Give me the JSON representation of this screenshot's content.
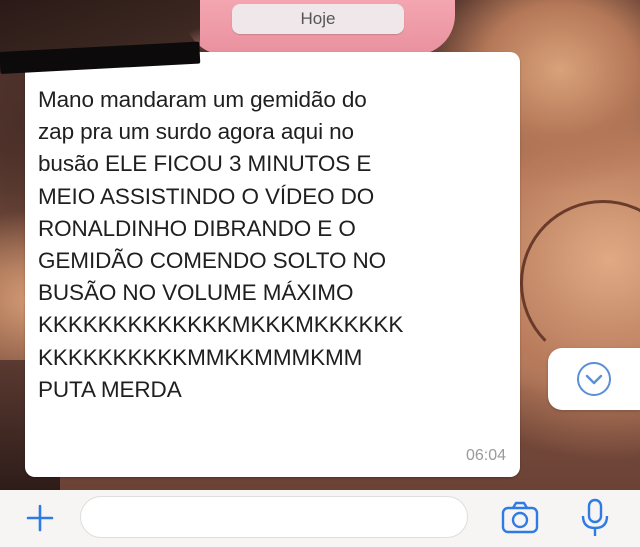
{
  "chat": {
    "date_label": "Hoje",
    "message": {
      "text": "Mano mandaram um gemidão do\nzap pra um surdo agora aqui no\nbusão ELE FICOU 3 MINUTOS E\nMEIO ASSISTINDO O VÍDEO DO\nRONALDINHO DIBRANDO E O\nGEMIDÃO COMENDO SOLTO NO\nBUSÃO NO VOLUME MÁXIMO\nKKKKKKKKKKKKKMKKKMKKKKKK\nKKKKKKKKKKMMKKMMMKMM\nPUTA MERDA",
      "time": "06:04"
    }
  },
  "composer": {
    "plus_icon": "plus-icon",
    "camera_icon": "camera-icon",
    "mic_icon": "microphone-icon",
    "accent_color": "#2f7be5"
  },
  "scroll_button": {
    "icon": "chevron-down-icon"
  }
}
